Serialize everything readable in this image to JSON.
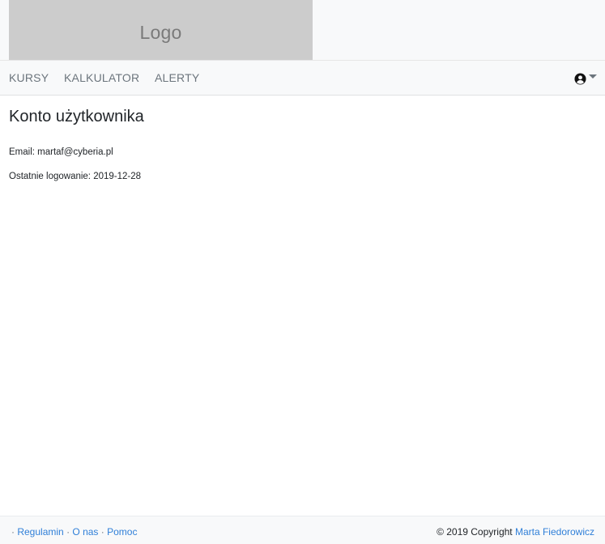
{
  "header": {
    "logo_text": "Logo"
  },
  "nav": {
    "items": [
      {
        "label": "KURSY"
      },
      {
        "label": "KALKULATOR"
      },
      {
        "label": "ALERTY"
      }
    ],
    "user_icon": "user-circle-icon"
  },
  "main": {
    "title": "Konto użytkownika",
    "email_label": "Email:",
    "email_value": "martaf@cyberia.pl",
    "last_login_label": "Ostatnie logowanie:",
    "last_login_value": "2019-12-28"
  },
  "footer": {
    "bullet": "·",
    "links": [
      {
        "label": "Regulamin"
      },
      {
        "label": "O nas"
      },
      {
        "label": "Pomoc"
      }
    ],
    "copyright": "© 2019 Copyright",
    "author": "Marta Fiedorowicz"
  },
  "colors": {
    "link": "#2f7fd8",
    "nav_text": "#6c757d",
    "logo_bg": "#cccccc",
    "bar_bg": "#f8f9fa"
  }
}
